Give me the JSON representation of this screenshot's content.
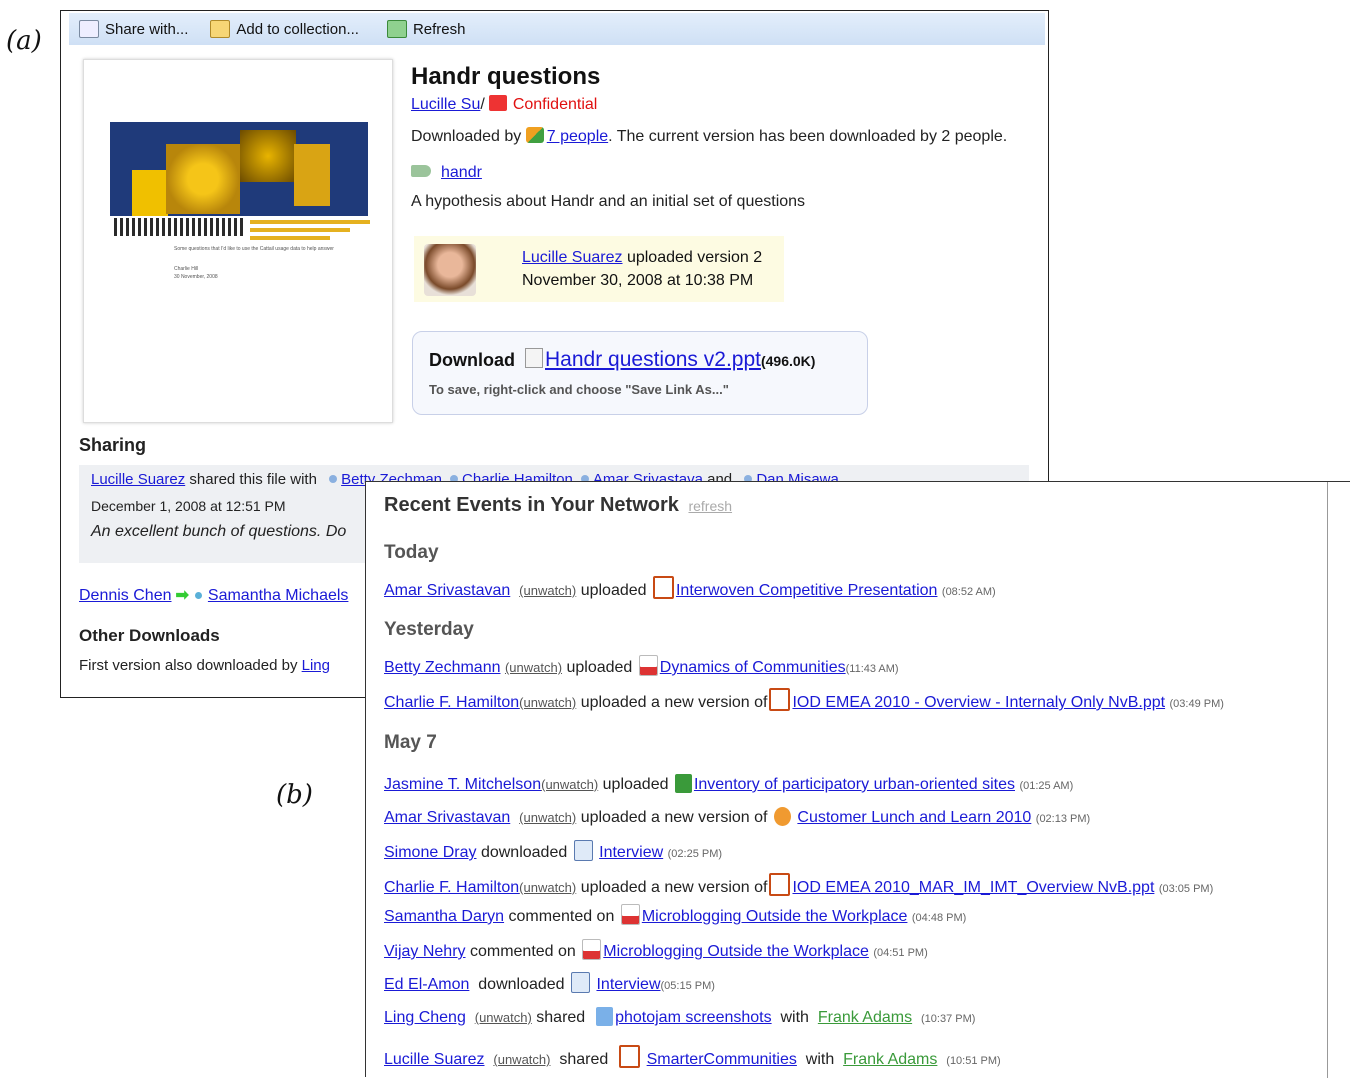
{
  "labels": {
    "a": "(a)",
    "b": "(b)"
  },
  "panel_a": {
    "toolbar": {
      "share": "Share with...",
      "collection": "Add to collection...",
      "refresh": "Refresh"
    },
    "doc_title": "Handr questions",
    "owner": "Lucille Su",
    "owner_sep": "/",
    "confidential": "Confidential",
    "downloaded_prefix": "Downloaded by",
    "downloaded_link": "7 people",
    "downloaded_suffix": ". The current version has been downloaded by 2 people.",
    "tag": "handr",
    "description": "A hypothesis about Handr and an initial set of questions",
    "upload": {
      "user": "Lucille Suarez",
      "action": " uploaded version 2",
      "date": "November 30, 2008 at 10:38 PM"
    },
    "download": {
      "label": "Download",
      "file": "Handr questions v2.ppt",
      "size": "(496.0K)",
      "hint": "To save, right-click and choose \"Save Link As...\""
    },
    "thumbnail": {
      "text1": "Some questions that I'd like to use the Cattail usage data to help answer",
      "text2": "Charlie Hill",
      "text3": "30 November, 2008"
    },
    "sharing": {
      "heading": "Sharing",
      "sharer": "Lucille Suarez",
      "shared_text": " shared this file with ",
      "recipients": [
        "Betty Zechman",
        "Charlie Hamilton",
        "Amar Srivastava"
      ],
      "and": " and ",
      "last": "Dan Misawa",
      "date": "December 1, 2008 at 12:51 PM",
      "comment": "An excellent bunch of questions. Do"
    },
    "forward": {
      "from": "Dennis Chen",
      "to": "Samantha Michaels"
    },
    "other": {
      "heading": "Other Downloads",
      "text": "First version also downloaded by ",
      "link": "Ling"
    }
  },
  "panel_b": {
    "title": "Recent Events in Your Network",
    "refresh": "refresh",
    "days": [
      "Today",
      "Yesterday",
      "May 7"
    ],
    "events": [
      {
        "user": "Amar Srivastavan",
        "watch": "(unwatch)",
        "action": "uploaded",
        "file": "Interwoven Competitive Presentation",
        "time": "(08:52 AM)"
      },
      {
        "user": "Betty Zechmann",
        "watch": "(unwatch)",
        "action": "uploaded",
        "file": "Dynamics of Communities",
        "time": "(11:43 AM)"
      },
      {
        "user": "Charlie F. Hamilton",
        "watch": "(unwatch)",
        "action": "uploaded a new version of",
        "file": "IOD EMEA 2010 - Overview - Internaly Only NvB.ppt",
        "time": "(03:49 PM)"
      },
      {
        "user": "Jasmine T. Mitchelson",
        "watch": "(unwatch)",
        "action": "uploaded",
        "file": "Inventory of participatory urban-oriented sites",
        "time": "(01:25 AM)"
      },
      {
        "user": "Amar Srivastavan",
        "watch": "(unwatch)",
        "action": "uploaded a new version of",
        "file": "Customer Lunch and Learn 2010",
        "time": "(02:13 PM)"
      },
      {
        "user": "Simone Dray",
        "action": "downloaded",
        "file": "Interview",
        "time": "(02:25 PM)"
      },
      {
        "user": "Charlie F. Hamilton",
        "watch": "(unwatch)",
        "action": "uploaded a new version of",
        "file": "IOD EMEA 2010_MAR_IM_IMT_Overview NvB.ppt",
        "time": "(03:05 PM)"
      },
      {
        "user": "Samantha Daryn",
        "action": "commented on",
        "file": "Microblogging Outside the Workplace",
        "time": "(04:48 PM)"
      },
      {
        "user": "Vijay Nehry",
        "action": "commented on",
        "file": "Microblogging Outside the Workplace",
        "time": "(04:51 PM)"
      },
      {
        "user": "Ed El-Amon",
        "action": "downloaded",
        "file": "Interview",
        "time": "(05:15 PM)"
      },
      {
        "user": "Ling Cheng",
        "watch": "(unwatch)",
        "action": "shared",
        "file": "photojam screenshots",
        "with": "with",
        "target": "Frank Adams",
        "time": "(10:37 PM)"
      },
      {
        "user": "Lucille Suarez",
        "watch": "(unwatch)",
        "action": "shared",
        "file": "SmarterCommunities",
        "with": "with",
        "target": "Frank Adams",
        "time": "(10:51 PM)"
      }
    ]
  }
}
